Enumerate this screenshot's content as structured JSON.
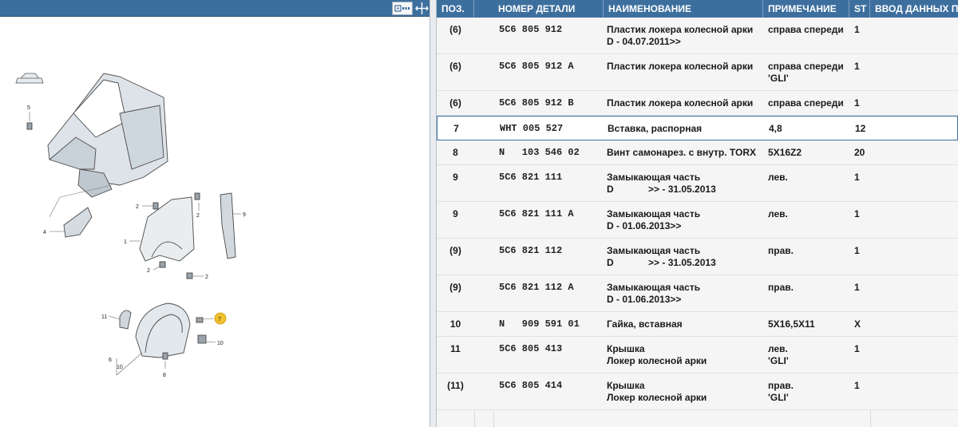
{
  "toolbar": {
    "zoom_icon": "zoom-fit-icon",
    "split_icon": "split-arrows-icon"
  },
  "diagram": {
    "callouts": [
      "5",
      "2",
      "2",
      "9",
      "4",
      "1",
      "2",
      "2",
      "11",
      "7",
      "10",
      "6",
      "10",
      "8"
    ]
  },
  "table": {
    "headers": [
      "ПОЗ.",
      "НОМЕР ДЕТАЛИ",
      "НАИМЕНОВАНИЕ",
      "ПРИМЕЧАНИЕ",
      "ST",
      "ВВОД ДАННЫХ П"
    ],
    "rows": [
      {
        "pos": "(6)",
        "num": "5C6 805 912",
        "name": [
          "Пластик локера колесной арки",
          "D - 04.07.2011>>"
        ],
        "note": [
          "справа спереди"
        ],
        "st": "1"
      },
      {
        "pos": "(6)",
        "num": "5C6 805 912 A",
        "name": [
          "Пластик локера колесной арки"
        ],
        "note": [
          "справа спереди",
          "'GLI'"
        ],
        "st": "1"
      },
      {
        "pos": "(6)",
        "num": "5C6 805 912 B",
        "name": [
          "Пластик локера колесной арки"
        ],
        "note": [
          "справа спереди"
        ],
        "st": "1"
      },
      {
        "pos": "7",
        "num": "WHT 005 527",
        "name": [
          "Вставка, распорная"
        ],
        "note": [
          "4,8"
        ],
        "st": "12",
        "selected": true
      },
      {
        "pos": "8",
        "num": "N   103 546 02",
        "name": [
          "Винт самонарез. с внутр. TORX"
        ],
        "note": [
          "5X16Z2"
        ],
        "st": "20"
      },
      {
        "pos": "9",
        "num": "5C6 821 111",
        "name": [
          "Замыкающая часть",
          "D             >> - 31.05.2013"
        ],
        "note": [
          "лев."
        ],
        "st": "1"
      },
      {
        "pos": "9",
        "num": "5C6 821 111 A",
        "name": [
          "Замыкающая часть",
          "D - 01.06.2013>>"
        ],
        "note": [
          "лев."
        ],
        "st": "1"
      },
      {
        "pos": "(9)",
        "num": "5C6 821 112",
        "name": [
          "Замыкающая часть",
          "D             >> - 31.05.2013"
        ],
        "note": [
          "прав."
        ],
        "st": "1"
      },
      {
        "pos": "(9)",
        "num": "5C6 821 112 A",
        "name": [
          "Замыкающая часть",
          "D - 01.06.2013>>"
        ],
        "note": [
          "прав."
        ],
        "st": "1"
      },
      {
        "pos": "10",
        "num": "N   909 591 01",
        "name": [
          "Гайка, вставная"
        ],
        "note": [
          "5X16,5X11"
        ],
        "st": "X"
      },
      {
        "pos": "11",
        "num": "5C6 805 413",
        "name": [
          "Крышка",
          "Локер колесной арки"
        ],
        "note": [
          "лев.",
          "'GLI'"
        ],
        "st": "1"
      },
      {
        "pos": "(11)",
        "num": "5C6 805 414",
        "name": [
          "Крышка",
          "Локер колесной арки"
        ],
        "note": [
          "прав.",
          "'GLI'"
        ],
        "st": "1"
      }
    ]
  },
  "colors": {
    "header_bg": "#3d6f9e",
    "highlight": "#f2c12e"
  }
}
